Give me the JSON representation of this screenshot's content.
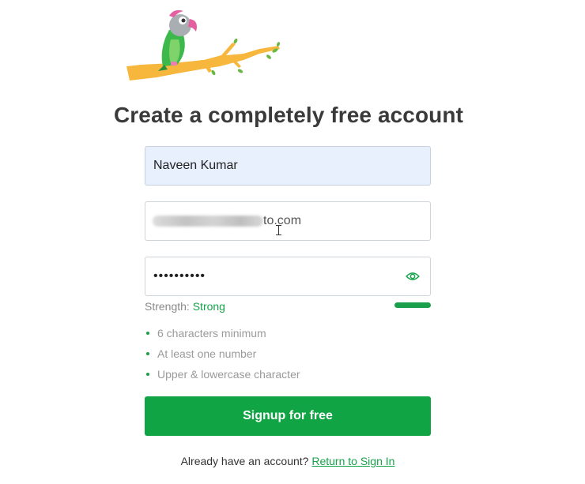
{
  "page": {
    "title": "Create a completely free account"
  },
  "form": {
    "name_value": "Naveen Kumar",
    "email_visible_suffix": "to.com",
    "password_masked": "••••••••••",
    "password_toggle_icon": "eye-icon"
  },
  "strength": {
    "label": "Strength:",
    "value": "Strong",
    "level_fraction": 1.0,
    "color": "#17a34a"
  },
  "rules": [
    {
      "text": "6 characters minimum"
    },
    {
      "text": "At least one number"
    },
    {
      "text": "Upper & lowercase character"
    }
  ],
  "signup": {
    "label": "Signup for free",
    "color": "#10a444"
  },
  "footer": {
    "prompt": "Already have an account?",
    "link_label": "Return to Sign In"
  },
  "logo": {
    "icon": "parrot-on-branch-logo"
  }
}
